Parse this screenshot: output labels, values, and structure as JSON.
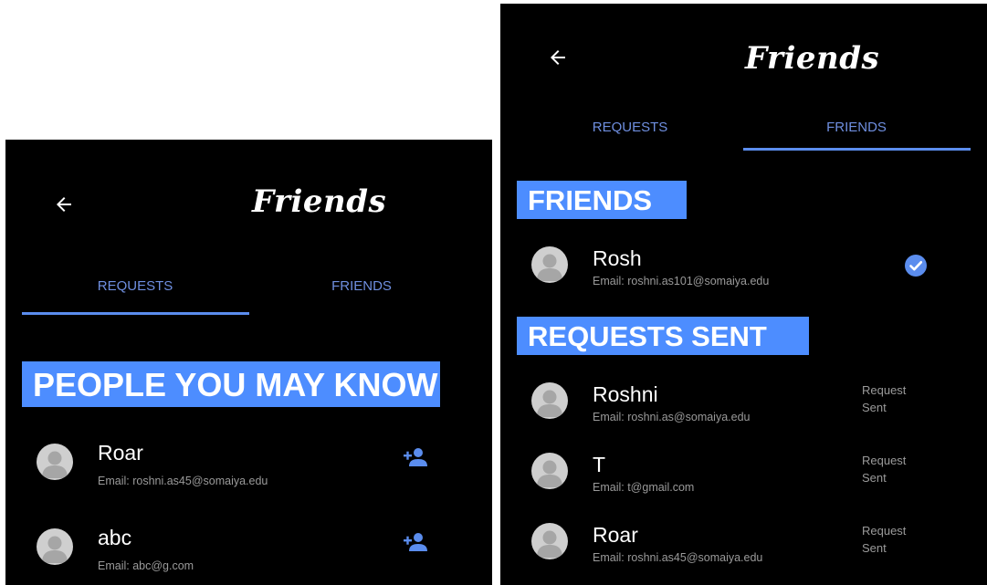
{
  "colors": {
    "background": "#000000",
    "accent": "#4d8dff",
    "tab_text": "#6f8fe0",
    "secondary_text": "#9a9a9a",
    "avatar": "#cfcfcf"
  },
  "left": {
    "title": "Friends",
    "back_icon": "arrow-left-icon",
    "tabs": [
      {
        "label": "REQUESTS",
        "selected": true
      },
      {
        "label": "FRIENDS",
        "selected": false
      }
    ],
    "section_header": "PEOPLE YOU MAY KNOW",
    "people": [
      {
        "name": "Roar",
        "email": "Email: roshni.as45@somaiya.edu",
        "action_icon": "add-person-icon"
      },
      {
        "name": "abc",
        "email": "Email: abc@g.com",
        "action_icon": "add-person-icon"
      }
    ]
  },
  "right": {
    "title": "Friends",
    "back_icon": "arrow-left-icon",
    "tabs": [
      {
        "label": "REQUESTS",
        "selected": false
      },
      {
        "label": "FRIENDS",
        "selected": true
      }
    ],
    "friends_header": "FRIENDS",
    "friends": [
      {
        "name": "Rosh",
        "email": "Email: roshni.as101@somaiya.edu",
        "status_icon": "check-circle-icon"
      }
    ],
    "sent_header": "REQUESTS SENT",
    "sent": [
      {
        "name": "Roshni",
        "email": "Email: roshni.as@somaiya.edu",
        "status_line1": "Request",
        "status_line2": "Sent"
      },
      {
        "name": "T",
        "email": "Email: t@gmail.com",
        "status_line1": "Request",
        "status_line2": "Sent"
      },
      {
        "name": "Roar",
        "email": "Email: roshni.as45@somaiya.edu",
        "status_line1": "Request",
        "status_line2": "Sent"
      }
    ]
  }
}
